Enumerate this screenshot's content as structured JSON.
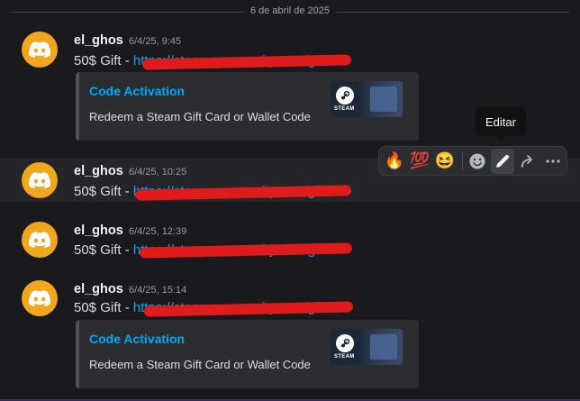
{
  "date_divider": "6 de abril de 2025",
  "messages": [
    {
      "author": "el_ghos",
      "time": "6/4/25, 9:45",
      "text": "50$ Gift - ",
      "link": "https://steamcommunity.com/gift",
      "embed": {
        "title": "Code Activation",
        "description": "Redeem a Steam Gift Card or Wallet Code",
        "thumb_label": "STEAM"
      }
    },
    {
      "author": "el_ghos",
      "time": "6/4/25, 10:25",
      "text": "50$ Gift - ",
      "link": "https://steamcommunity.com/gift"
    },
    {
      "author": "el_ghos",
      "time": "6/4/25, 12:39",
      "text": "50$ Gift - ",
      "link": "https://steamcommunity.com/gift"
    },
    {
      "author": "el_ghos",
      "time": "6/4/25, 15:14",
      "text": "50$ Gift - ",
      "link": "https://steamcommunity.com/gift",
      "embed": {
        "title": "Code Activation",
        "description": "Redeem a Steam Gift Card or Wallet Code",
        "thumb_label": "STEAM"
      }
    }
  ],
  "toolbar": {
    "reactions": [
      "🔥",
      "💯",
      "😆"
    ],
    "add_reaction_icon": "smile-icon",
    "edit_icon": "pencil-icon",
    "forward_icon": "forward-arrow-icon",
    "more_icon": "more-dots-icon",
    "tooltip": "Editar"
  },
  "colors": {
    "avatar": "#f0a71c",
    "link": "#00a8fc",
    "redaction": "#e01b1b"
  }
}
